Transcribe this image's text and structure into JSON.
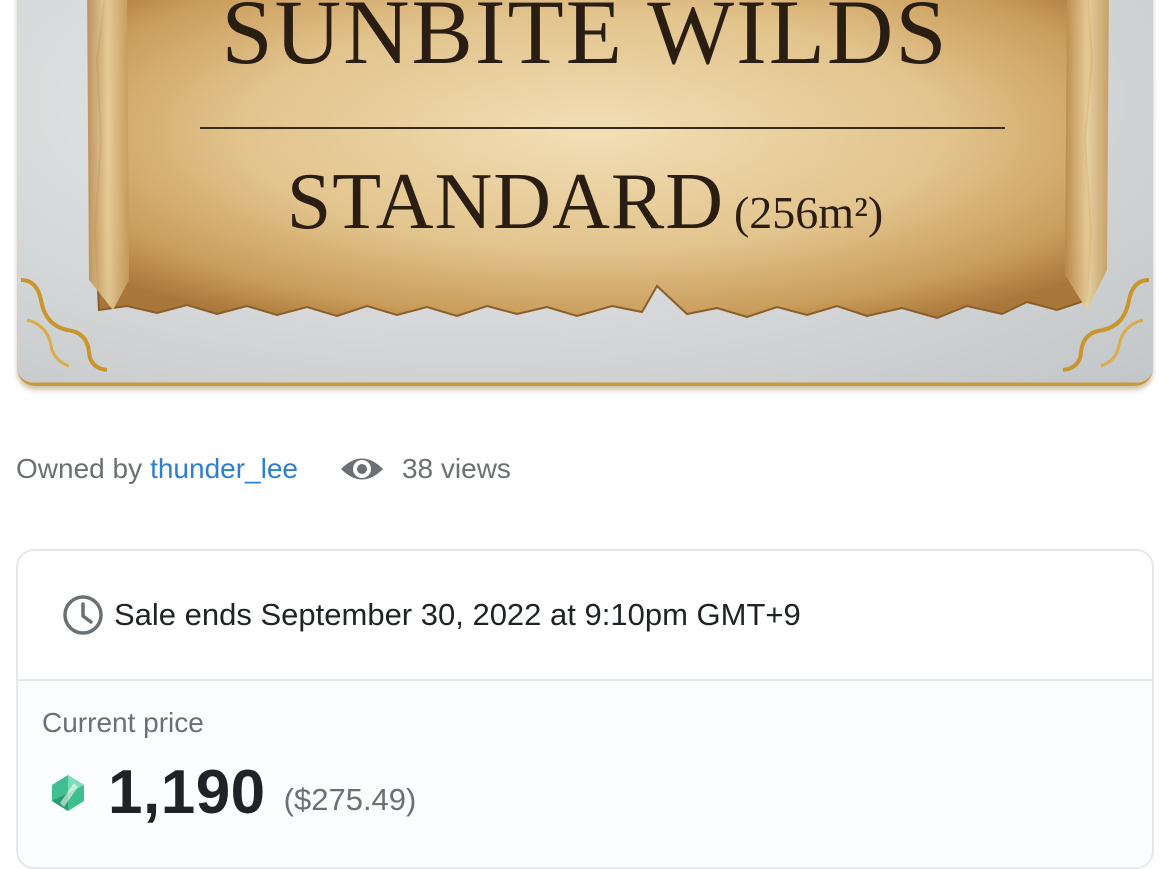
{
  "artwork": {
    "title": "SUNBITE WILDS",
    "size_name": "STANDARD",
    "size_area": "(256m²)"
  },
  "owner": {
    "prefix": "Owned by",
    "username": "thunder_lee"
  },
  "views": {
    "icon": "eye-icon",
    "text": "38 views"
  },
  "sale": {
    "icon": "clock-icon",
    "ends_text": "Sale ends September 30, 2022 at 9:10pm GMT+9"
  },
  "price": {
    "label": "Current price",
    "token_icon": "token-icon",
    "amount": "1,190",
    "usd": "($275.49)"
  },
  "colors": {
    "link": "#2f7fd0",
    "token": "#3fbf8f",
    "border": "#e5e8eb"
  }
}
